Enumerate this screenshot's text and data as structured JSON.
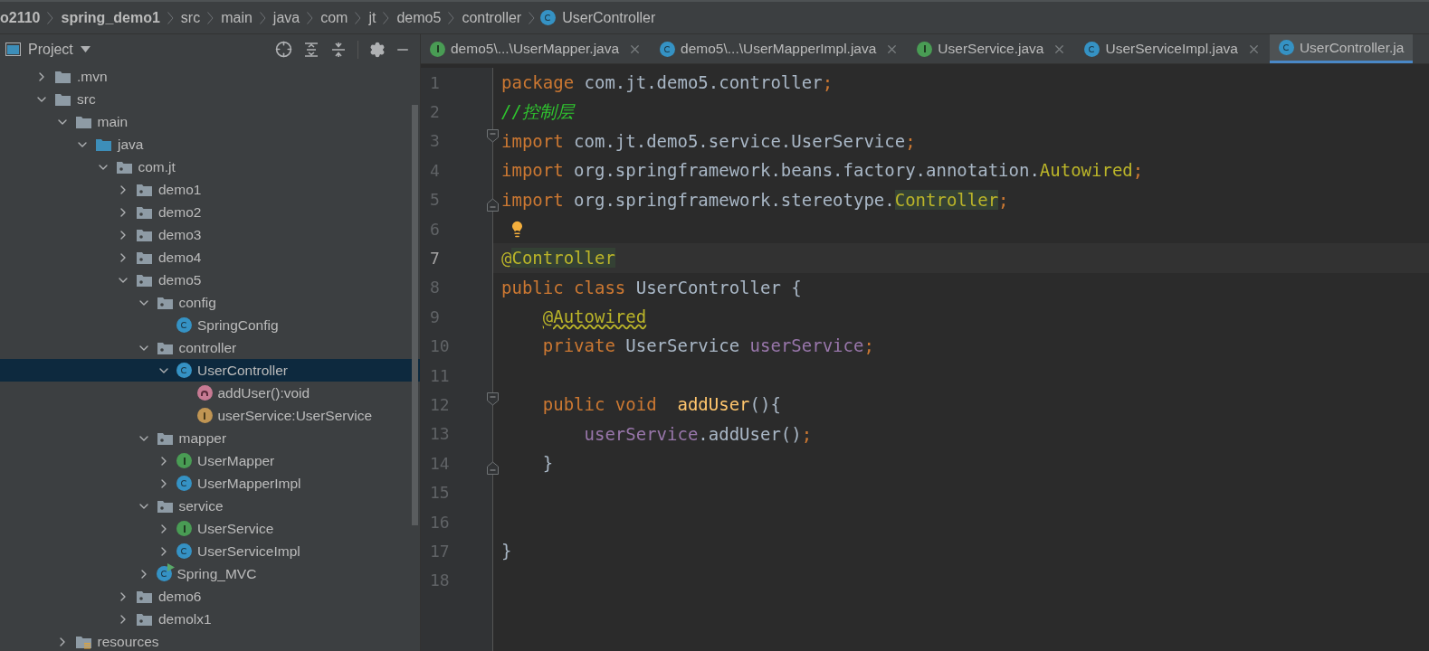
{
  "breadcrumbs": [
    {
      "label": "o2110",
      "bold": true,
      "kind": "text"
    },
    {
      "label": "spring_demo1",
      "bold": true,
      "kind": "text"
    },
    {
      "label": "src",
      "bold": false,
      "kind": "text"
    },
    {
      "label": "main",
      "bold": false,
      "kind": "text"
    },
    {
      "label": "java",
      "bold": false,
      "kind": "text"
    },
    {
      "label": "com",
      "bold": false,
      "kind": "text"
    },
    {
      "label": "jt",
      "bold": false,
      "kind": "text"
    },
    {
      "label": "demo5",
      "bold": false,
      "kind": "text"
    },
    {
      "label": "controller",
      "bold": false,
      "kind": "text"
    },
    {
      "label": "UserController",
      "bold": false,
      "kind": "class"
    }
  ],
  "project_panel": {
    "title": "Project",
    "tree": [
      {
        "label": ".mvn",
        "kind": "folder",
        "expanded": false,
        "selected": false
      },
      {
        "label": "src",
        "kind": "folder",
        "expanded": true,
        "selected": false,
        "children": [
          {
            "label": "main",
            "kind": "folder",
            "expanded": true,
            "selected": false,
            "children": [
              {
                "label": "java",
                "kind": "source",
                "expanded": true,
                "selected": false,
                "children": [
                  {
                    "label": "com.jt",
                    "kind": "package",
                    "expanded": true,
                    "selected": false,
                    "children": [
                      {
                        "label": "demo1",
                        "kind": "package",
                        "expanded": false,
                        "selected": false
                      },
                      {
                        "label": "demo2",
                        "kind": "package",
                        "expanded": false,
                        "selected": false
                      },
                      {
                        "label": "demo3",
                        "kind": "package",
                        "expanded": false,
                        "selected": false
                      },
                      {
                        "label": "demo4",
                        "kind": "package",
                        "expanded": false,
                        "selected": false
                      },
                      {
                        "label": "demo5",
                        "kind": "package",
                        "expanded": true,
                        "selected": false,
                        "children": [
                          {
                            "label": "config",
                            "kind": "package",
                            "expanded": true,
                            "selected": false,
                            "children": [
                              {
                                "label": "SpringConfig",
                                "kind": "class",
                                "selected": false
                              }
                            ]
                          },
                          {
                            "label": "controller",
                            "kind": "package",
                            "expanded": true,
                            "selected": false,
                            "children": [
                              {
                                "label": "UserController",
                                "kind": "class",
                                "expanded": true,
                                "selected": true,
                                "children": [
                                  {
                                    "label": "addUser():void",
                                    "kind": "method",
                                    "selected": false
                                  },
                                  {
                                    "label": "userService:UserService",
                                    "kind": "field",
                                    "selected": false
                                  }
                                ]
                              }
                            ]
                          },
                          {
                            "label": "mapper",
                            "kind": "package",
                            "expanded": true,
                            "selected": false,
                            "children": [
                              {
                                "label": "UserMapper",
                                "kind": "interface",
                                "expanded": false,
                                "selected": false
                              },
                              {
                                "label": "UserMapperImpl",
                                "kind": "class",
                                "expanded": false,
                                "selected": false
                              }
                            ]
                          },
                          {
                            "label": "service",
                            "kind": "package",
                            "expanded": true,
                            "selected": false,
                            "children": [
                              {
                                "label": "UserService",
                                "kind": "interface",
                                "expanded": false,
                                "selected": false
                              },
                              {
                                "label": "UserServiceImpl",
                                "kind": "class",
                                "expanded": false,
                                "selected": false
                              }
                            ]
                          },
                          {
                            "label": "Spring_MVC",
                            "kind": "app",
                            "expanded": false,
                            "selected": false
                          }
                        ]
                      },
                      {
                        "label": "demo6",
                        "kind": "package",
                        "expanded": false,
                        "selected": false
                      },
                      {
                        "label": "demolx1",
                        "kind": "package",
                        "expanded": false,
                        "selected": false
                      }
                    ]
                  }
                ]
              }
            ]
          },
          {
            "label": "resources",
            "kind": "resources",
            "expanded": false,
            "selected": false
          }
        ]
      }
    ]
  },
  "tabs": [
    {
      "label": "demo5\\...\\UserMapper.java",
      "kind": "interface",
      "selected": false,
      "closable": true
    },
    {
      "label": "demo5\\...\\UserMapperImpl.java",
      "kind": "class",
      "selected": false,
      "closable": true
    },
    {
      "label": "UserService.java",
      "kind": "interface",
      "selected": false,
      "closable": true
    },
    {
      "label": "UserServiceImpl.java",
      "kind": "class",
      "selected": false,
      "closable": true
    },
    {
      "label": "UserController.ja",
      "kind": "class",
      "selected": true,
      "closable": false
    }
  ],
  "editor": {
    "lines": [
      {
        "number": "1",
        "current": false,
        "fold_open": false,
        "fold_close": false,
        "intention": false,
        "tokens": [
          {
            "kind": "keyword",
            "text": "package"
          },
          {
            "kind": "plain",
            "text": " com.jt.demo5.controller"
          },
          {
            "kind": "keyword",
            "text": ";"
          }
        ]
      },
      {
        "number": "2",
        "current": false,
        "fold_open": false,
        "fold_close": false,
        "intention": false,
        "tokens": [
          {
            "kind": "comment",
            "text": "//控制层"
          }
        ]
      },
      {
        "number": "3",
        "current": false,
        "fold_open": true,
        "fold_close": false,
        "intention": false,
        "tokens": [
          {
            "kind": "keyword",
            "text": "import"
          },
          {
            "kind": "plain",
            "text": " com.jt.demo5.service.UserService"
          },
          {
            "kind": "keyword",
            "text": ";"
          }
        ]
      },
      {
        "number": "4",
        "current": false,
        "fold_open": false,
        "fold_close": false,
        "intention": false,
        "tokens": [
          {
            "kind": "keyword",
            "text": "import"
          },
          {
            "kind": "plain",
            "text": " org.springframework.beans.factory.annotation."
          },
          {
            "kind": "annotation",
            "text": "Autowired"
          },
          {
            "kind": "keyword",
            "text": ";"
          }
        ]
      },
      {
        "number": "5",
        "current": false,
        "fold_open": false,
        "fold_close": true,
        "intention": false,
        "tokens": [
          {
            "kind": "keyword",
            "text": "import"
          },
          {
            "kind": "plain",
            "text": " org.springframework.stereotype."
          },
          {
            "kind": "highlight",
            "text": "Controller"
          },
          {
            "kind": "keyword",
            "text": ";"
          }
        ]
      },
      {
        "number": "6",
        "current": false,
        "fold_open": false,
        "fold_close": false,
        "intention": true
      },
      {
        "number": "7",
        "current": true,
        "fold_open": false,
        "fold_close": false,
        "intention": false,
        "tokens": [
          {
            "kind": "annotation",
            "text": "@"
          },
          {
            "kind": "highlight",
            "text": "Controller"
          }
        ]
      },
      {
        "number": "8",
        "current": false,
        "fold_open": false,
        "fold_close": false,
        "intention": false,
        "tokens": [
          {
            "kind": "keyword",
            "text": "public class "
          },
          {
            "kind": "plain",
            "text": "UserController {"
          }
        ]
      },
      {
        "number": "9",
        "current": false,
        "fold_open": false,
        "fold_close": false,
        "intention": false,
        "tokens": [
          {
            "kind": "warning",
            "text": "    @Autowired"
          }
        ]
      },
      {
        "number": "10",
        "current": false,
        "fold_open": false,
        "fold_close": false,
        "intention": false,
        "tokens": [
          {
            "kind": "keyword",
            "text": "    private "
          },
          {
            "kind": "plain",
            "text": "UserService "
          },
          {
            "kind": "field",
            "text": "userService"
          },
          {
            "kind": "keyword",
            "text": ";"
          }
        ]
      },
      {
        "number": "11",
        "current": false,
        "fold_open": false,
        "fold_close": false,
        "intention": false
      },
      {
        "number": "12",
        "current": false,
        "fold_open": true,
        "fold_close": false,
        "intention": false,
        "tokens": [
          {
            "kind": "keyword",
            "text": "    public void  "
          },
          {
            "kind": "method",
            "text": "addUser"
          },
          {
            "kind": "plain",
            "text": "(){"
          }
        ]
      },
      {
        "number": "13",
        "current": false,
        "fold_open": false,
        "fold_close": false,
        "intention": false,
        "tokens": [
          {
            "kind": "field",
            "text": "        userService"
          },
          {
            "kind": "plain",
            "text": ".addUser()"
          },
          {
            "kind": "keyword",
            "text": ";"
          }
        ]
      },
      {
        "number": "14",
        "current": false,
        "fold_open": false,
        "fold_close": true,
        "intention": false,
        "tokens": [
          {
            "kind": "plain",
            "text": "    }"
          }
        ]
      },
      {
        "number": "15",
        "current": false,
        "fold_open": false,
        "fold_close": false,
        "intention": false
      },
      {
        "number": "16",
        "current": false,
        "fold_open": false,
        "fold_close": false,
        "intention": false
      },
      {
        "number": "17",
        "current": false,
        "fold_open": false,
        "fold_close": false,
        "intention": false,
        "tokens": [
          {
            "kind": "plain",
            "text": "}"
          }
        ]
      },
      {
        "number": "18",
        "current": false,
        "fold_open": false,
        "fold_close": false,
        "intention": false
      }
    ]
  }
}
